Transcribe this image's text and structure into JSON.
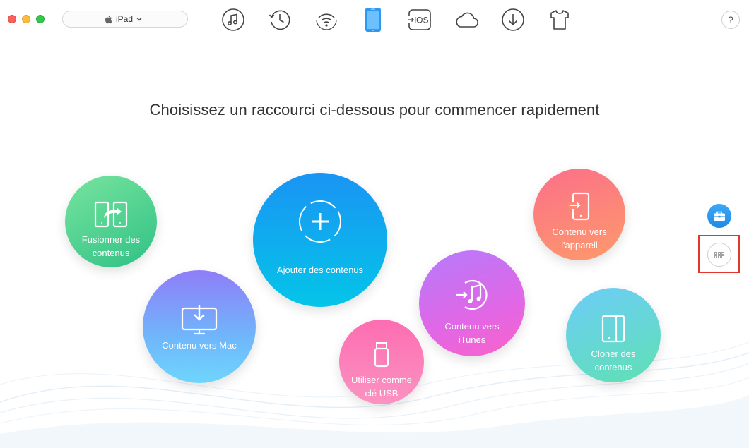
{
  "toolbar": {
    "device_name": "iPad",
    "tools": [
      {
        "name": "music-icon"
      },
      {
        "name": "history-icon"
      },
      {
        "name": "wifi-sync-icon"
      },
      {
        "name": "device-icon",
        "active": true
      },
      {
        "name": "to-ios-icon",
        "text": "iOS"
      },
      {
        "name": "cloud-icon"
      },
      {
        "name": "download-icon"
      },
      {
        "name": "shirt-icon"
      }
    ],
    "help_label": "?"
  },
  "main": {
    "headline": "Choisissez un raccourci ci-dessous pour commencer rapidement",
    "shortcuts": {
      "merge": "Fusionner des contenus",
      "to_mac": "Contenu vers Mac",
      "add": "Ajouter des contenus",
      "usb": "Utiliser comme clé USB",
      "to_itunes": "Contenu vers iTunes",
      "to_device": "Contenu vers l'appareil",
      "clone": "Cloner des contenus"
    }
  },
  "colors": {
    "accent": "#1a94f4",
    "highlight": "#e0382c"
  }
}
